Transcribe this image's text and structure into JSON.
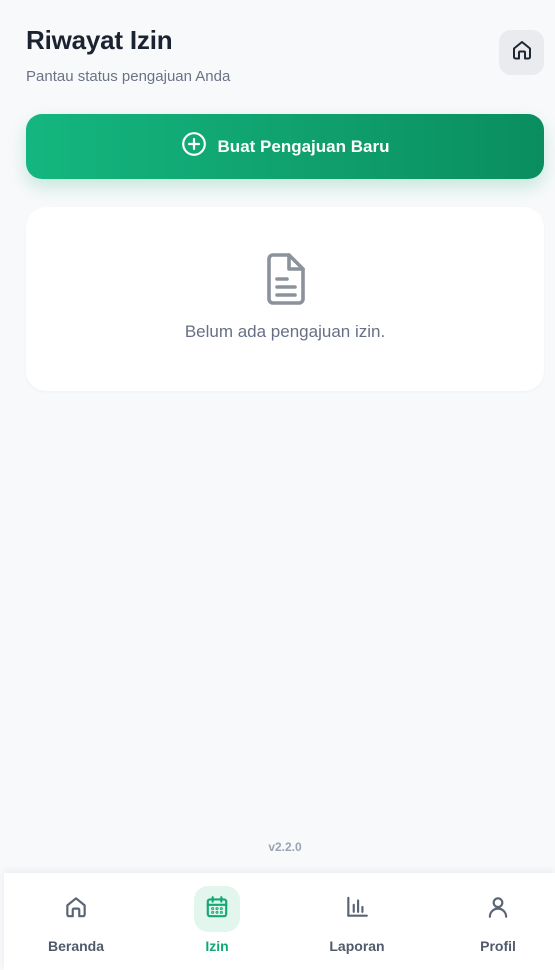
{
  "header": {
    "title": "Riwayat Izin",
    "subtitle": "Pantau status pengajuan Anda"
  },
  "actions": {
    "home_icon": "home-icon",
    "create_label": "Buat Pengajuan Baru",
    "create_icon": "plus-circle-icon"
  },
  "empty_state": {
    "icon": "document-icon",
    "message": "Belum ada pengajuan izin."
  },
  "footer": {
    "version": "v2.2.0"
  },
  "bottom_nav": {
    "items": [
      {
        "label": "Beranda",
        "icon": "home-icon",
        "active": false
      },
      {
        "label": "Izin",
        "icon": "calendar-icon",
        "active": true
      },
      {
        "label": "Laporan",
        "icon": "bar-chart-icon",
        "active": false
      },
      {
        "label": "Profil",
        "icon": "user-icon",
        "active": false
      }
    ]
  },
  "colors": {
    "accent": "#13a874",
    "accent_light": "#e3f6ee",
    "background": "#f8f9fb"
  }
}
